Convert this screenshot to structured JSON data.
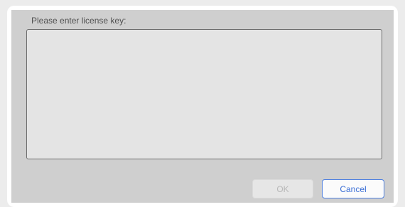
{
  "dialog": {
    "prompt_label": "Please enter license key:",
    "license_field": {
      "value": "",
      "placeholder": ""
    },
    "buttons": {
      "ok_label": "OK",
      "ok_enabled": false,
      "cancel_label": "Cancel"
    }
  },
  "colors": {
    "dialog_background": "#cfcfcf",
    "field_background": "#e4e4e4",
    "cancel_accent": "#3b6fd6",
    "ok_disabled_text": "#b8b8b8"
  }
}
